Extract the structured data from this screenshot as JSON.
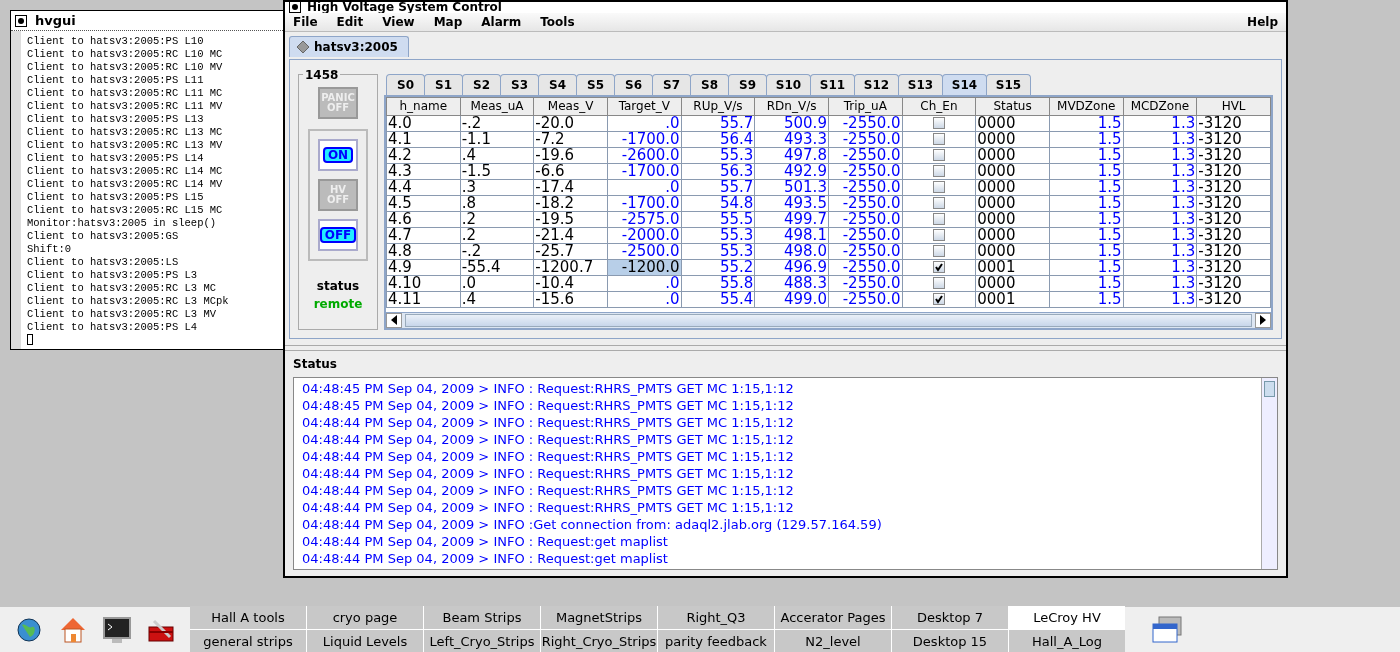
{
  "terminal": {
    "title": "hvgui",
    "lines": [
      "Client to hatsv3:2005:PS L10",
      "Client to hatsv3:2005:RC L10 MC",
      "Client to hatsv3:2005:RC L10 MV",
      "Client to hatsv3:2005:PS L11",
      "Client to hatsv3:2005:RC L11 MC",
      "Client to hatsv3:2005:RC L11 MV",
      "Client to hatsv3:2005:PS L13",
      "Client to hatsv3:2005:RC L13 MC",
      "Client to hatsv3:2005:RC L13 MV",
      "Client to hatsv3:2005:PS L14",
      "Client to hatsv3:2005:RC L14 MC",
      "Client to hatsv3:2005:RC L14 MV",
      "Client to hatsv3:2005:PS L15",
      "Client to hatsv3:2005:RC L15 MC",
      "Monitor:hatsv3:2005 in sleep()",
      "Client to hatsv3:2005:GS",
      "Shift:0",
      "Client to hatsv3:2005:LS",
      "Client to hatsv3:2005:PS L3",
      "Client to hatsv3:2005:RC L3 MC",
      "Client to hatsv3:2005:RC L3 MCpk",
      "Client to hatsv3:2005:RC L3 MV",
      "Client to hatsv3:2005:PS L4"
    ]
  },
  "window": {
    "title": "High Voltage System Control"
  },
  "menu": [
    "File",
    "Edit",
    "View",
    "Map",
    "Alarm",
    "Tools"
  ],
  "help_menu": "Help",
  "crate_tab": {
    "label": "hatsv3:2005",
    "selected": true
  },
  "control_panel": {
    "label": "1458",
    "buttons": [
      {
        "kind": "panic",
        "label": "PANIC OFF",
        "disabled": true
      },
      {
        "kind": "on",
        "label": "ON",
        "disabled": false
      },
      {
        "kind": "hv",
        "label": "HV OFF",
        "disabled": true
      },
      {
        "kind": "off",
        "label": "OFF",
        "disabled": false
      }
    ],
    "status_label": "status",
    "status_value": "remote"
  },
  "slot_tabs": [
    {
      "label": "S0",
      "selected": false
    },
    {
      "label": "S1",
      "selected": false
    },
    {
      "label": "S2",
      "selected": false
    },
    {
      "label": "S3",
      "selected": false
    },
    {
      "label": "S4",
      "selected": false
    },
    {
      "label": "S5",
      "selected": false
    },
    {
      "label": "S6",
      "selected": false
    },
    {
      "label": "S7",
      "selected": false
    },
    {
      "label": "S8",
      "selected": false
    },
    {
      "label": "S9",
      "selected": false
    },
    {
      "label": "S10",
      "selected": false
    },
    {
      "label": "S11",
      "selected": false
    },
    {
      "label": "S12",
      "selected": false
    },
    {
      "label": "S13",
      "selected": false
    },
    {
      "label": "S14",
      "selected": true
    },
    {
      "label": "S15",
      "selected": false
    }
  ],
  "table": {
    "columns": [
      {
        "label": "h_name",
        "kind": "plain"
      },
      {
        "label": "Meas_uA",
        "kind": "plain"
      },
      {
        "label": "Meas_V",
        "kind": "plain"
      },
      {
        "label": "Target_V",
        "kind": "value"
      },
      {
        "label": "RUp_V/s",
        "kind": "value"
      },
      {
        "label": "RDn_V/s",
        "kind": "value"
      },
      {
        "label": "Trip_uA",
        "kind": "value"
      },
      {
        "label": "Ch_En",
        "kind": "check"
      },
      {
        "label": "Status",
        "kind": "plain"
      },
      {
        "label": "MVDZone",
        "kind": "value"
      },
      {
        "label": "MCDZone",
        "kind": "value"
      },
      {
        "label": "HVL",
        "kind": "plain"
      }
    ],
    "rows": [
      {
        "cells": [
          "4.0",
          "-.2",
          "-20.0",
          ".0",
          "55.7",
          "500.9",
          "-2550.0",
          "",
          "0000",
          "1.5",
          "1.3",
          "-3120"
        ],
        "enabled": false,
        "selected": false
      },
      {
        "cells": [
          "4.1",
          "-1.1",
          "-7.2",
          "-1700.0",
          "56.4",
          "493.3",
          "-2550.0",
          "",
          "0000",
          "1.5",
          "1.3",
          "-3120"
        ],
        "enabled": false,
        "selected": false
      },
      {
        "cells": [
          "4.2",
          ".4",
          "-19.6",
          "-2600.0",
          "55.3",
          "497.8",
          "-2550.0",
          "",
          "0000",
          "1.5",
          "1.3",
          "-3120"
        ],
        "enabled": false,
        "selected": false
      },
      {
        "cells": [
          "4.3",
          "-1.5",
          "-6.6",
          "-1700.0",
          "56.3",
          "492.9",
          "-2550.0",
          "",
          "0000",
          "1.5",
          "1.3",
          "-3120"
        ],
        "enabled": false,
        "selected": false
      },
      {
        "cells": [
          "4.4",
          ".3",
          "-17.4",
          ".0",
          "55.7",
          "501.3",
          "-2550.0",
          "",
          "0000",
          "1.5",
          "1.3",
          "-3120"
        ],
        "enabled": false,
        "selected": false
      },
      {
        "cells": [
          "4.5",
          ".8",
          "-18.2",
          "-1700.0",
          "54.8",
          "493.5",
          "-2550.0",
          "",
          "0000",
          "1.5",
          "1.3",
          "-3120"
        ],
        "enabled": false,
        "selected": false
      },
      {
        "cells": [
          "4.6",
          ".2",
          "-19.5",
          "-2575.0",
          "55.5",
          "499.7",
          "-2550.0",
          "",
          "0000",
          "1.5",
          "1.3",
          "-3120"
        ],
        "enabled": false,
        "selected": false
      },
      {
        "cells": [
          "4.7",
          ".2",
          "-21.4",
          "-2000.0",
          "55.3",
          "498.1",
          "-2550.0",
          "",
          "0000",
          "1.5",
          "1.3",
          "-3120"
        ],
        "enabled": false,
        "selected": false
      },
      {
        "cells": [
          "4.8",
          "-.2",
          "-25.7",
          "-2500.0",
          "55.3",
          "498.0",
          "-2550.0",
          "",
          "0000",
          "1.5",
          "1.3",
          "-3120"
        ],
        "enabled": false,
        "selected": false
      },
      {
        "cells": [
          "4.9",
          "-55.4",
          "-1200.7",
          "-1200.0",
          "55.2",
          "496.9",
          "-2550.0",
          "",
          "0001",
          "1.5",
          "1.3",
          "-3120"
        ],
        "enabled": true,
        "selected": true
      },
      {
        "cells": [
          "4.10",
          ".0",
          "-10.4",
          ".0",
          "55.8",
          "488.3",
          "-2550.0",
          "",
          "0000",
          "1.5",
          "1.3",
          "-3120"
        ],
        "enabled": false,
        "selected": false
      },
      {
        "cells": [
          "4.11",
          ".4",
          "-15.6",
          ".0",
          "55.4",
          "499.0",
          "-2550.0",
          "",
          "0001",
          "1.5",
          "1.3",
          "-3120"
        ],
        "enabled": true,
        "selected": false
      }
    ]
  },
  "status_panel": {
    "title": "Status",
    "log": [
      "04:48:45 PM Sep 04, 2009 > INFO : Request:RHRS_PMTS GET MC 1:15,1:12",
      "04:48:45 PM Sep 04, 2009 > INFO : Request:RHRS_PMTS GET MC 1:15,1:12",
      "04:48:44 PM Sep 04, 2009 > INFO : Request:RHRS_PMTS GET MC 1:15,1:12",
      "04:48:44 PM Sep 04, 2009 > INFO : Request:RHRS_PMTS GET MC 1:15,1:12",
      "04:48:44 PM Sep 04, 2009 > INFO : Request:RHRS_PMTS GET MC 1:15,1:12",
      "04:48:44 PM Sep 04, 2009 > INFO : Request:RHRS_PMTS GET MC 1:15,1:12",
      "04:48:44 PM Sep 04, 2009 > INFO : Request:RHRS_PMTS GET MC 1:15,1:12",
      "04:48:44 PM Sep 04, 2009 > INFO : Request:RHRS_PMTS GET MC 1:15,1:12",
      "04:48:44 PM Sep 04, 2009 > INFO :Get connection from: adaql2.jlab.org (129.57.164.59)",
      "04:48:44 PM Sep 04, 2009 > INFO : Request:get maplist",
      "04:48:44 PM Sep 04, 2009 > INFO : Request:get maplist"
    ]
  },
  "taskbar": {
    "launchers": [
      {
        "kind": "globe"
      },
      {
        "kind": "home"
      },
      {
        "kind": "terminal"
      },
      {
        "kind": "toolbox"
      }
    ],
    "pages": [
      {
        "label": "Hall A tools",
        "selected": false
      },
      {
        "label": "cryo page",
        "selected": false
      },
      {
        "label": "Beam Strips",
        "selected": false
      },
      {
        "label": "MagnetStrips",
        "selected": false
      },
      {
        "label": "Right_Q3",
        "selected": false
      },
      {
        "label": "Accerator Pages",
        "selected": false
      },
      {
        "label": "Desktop 7",
        "selected": false
      },
      {
        "label": "LeCroy HV",
        "selected": true
      },
      {
        "label": "general strips",
        "selected": false
      },
      {
        "label": "Liquid Levels",
        "selected": false
      },
      {
        "label": "Left_Cryo_Strips",
        "selected": false
      },
      {
        "label": "Right_Cryo_Strips",
        "selected": false
      },
      {
        "label": "parity feedback",
        "selected": false
      },
      {
        "label": "N2_level",
        "selected": false
      },
      {
        "label": "Desktop 15",
        "selected": false
      },
      {
        "label": "Hall_A_Log",
        "selected": false
      }
    ]
  }
}
